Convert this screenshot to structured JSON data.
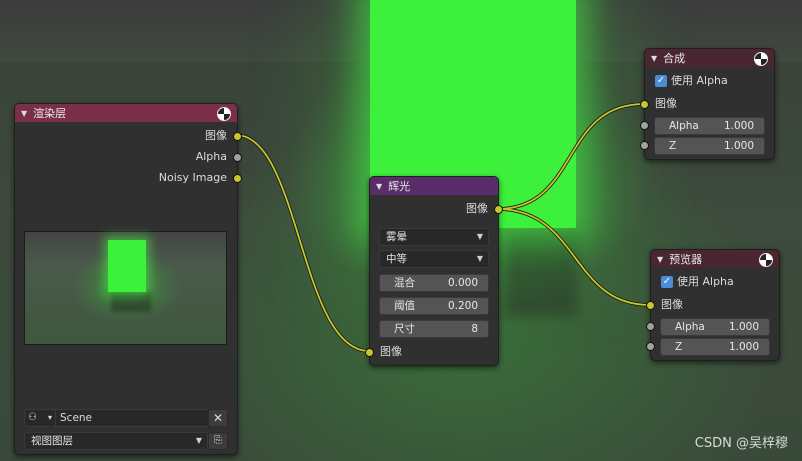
{
  "render_layers_node": {
    "title": "渲染层",
    "outputs": [
      "图像",
      "Alpha",
      "Noisy Image"
    ],
    "scene_value": "Scene",
    "view_layer_value": "视图图层"
  },
  "glow_node": {
    "title": "辉光",
    "output_label": "图像",
    "type_value": "雾晕",
    "quality_value": "中等",
    "mix_label": "混合",
    "mix_value": "0.000",
    "threshold_label": "阈值",
    "threshold_value": "0.200",
    "size_label": "尺寸",
    "size_value": "8",
    "input_label": "图像"
  },
  "composite_node": {
    "title": "合成",
    "use_alpha_label": "使用 Alpha",
    "use_alpha_checked": true,
    "image_label": "图像",
    "alpha_label": "Alpha",
    "alpha_value": "1.000",
    "z_label": "Z",
    "z_value": "1.000"
  },
  "viewer_node": {
    "title": "预览器",
    "use_alpha_label": "使用 Alpha",
    "use_alpha_checked": true,
    "image_label": "图像",
    "alpha_label": "Alpha",
    "alpha_value": "1.000",
    "z_label": "Z",
    "z_value": "1.000"
  },
  "watermark": "CSDN @吴梓穆",
  "colors": {
    "socket_color_image": "#c7c729",
    "socket_color_value": "#a1a1a1",
    "header_render_layers": "#7b2f46",
    "header_glow": "#5a2d6a",
    "header_output": "#4a2730",
    "checkbox": "#4a8dd6"
  }
}
